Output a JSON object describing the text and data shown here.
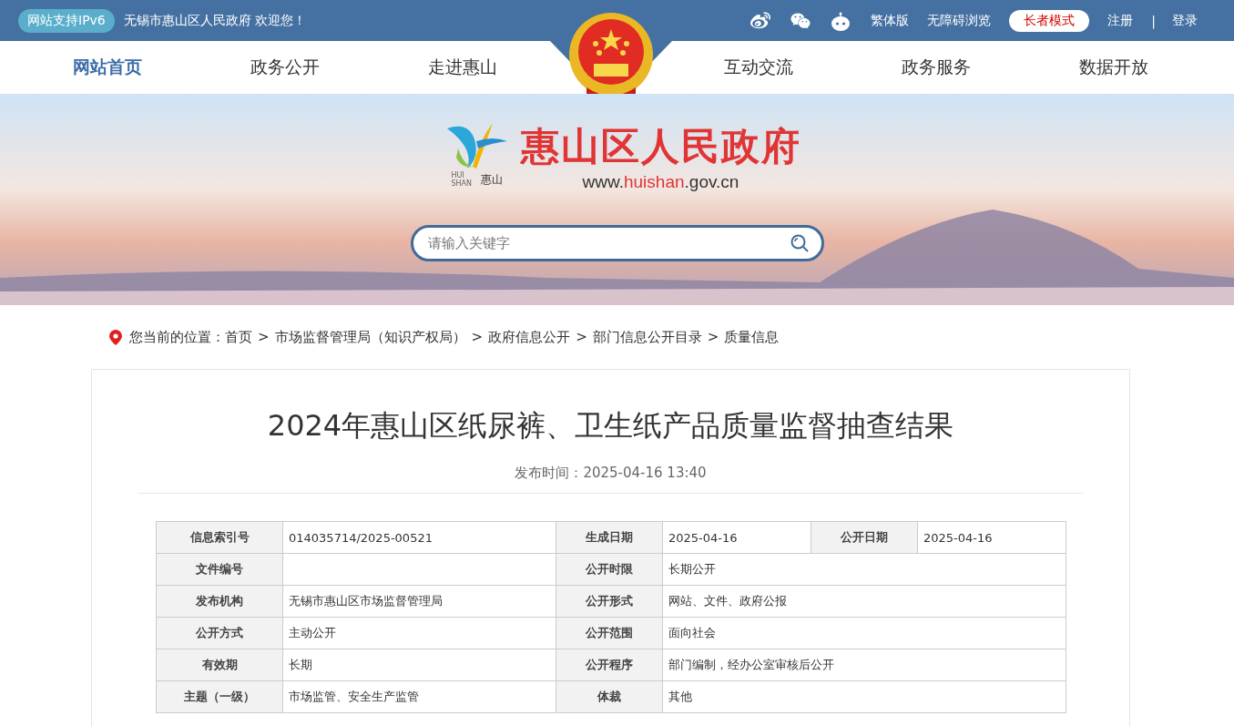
{
  "top_bar": {
    "ipv6_badge": "网站支持IPv6",
    "welcome": "无锡市惠山区人民政府 欢迎您！",
    "links": [
      "繁体版",
      "无障碍浏览"
    ],
    "elder_mode": "长者模式",
    "register": "注册",
    "divider": "|",
    "login": "登录"
  },
  "nav": {
    "items": [
      {
        "label": "网站首页",
        "selected": true
      },
      {
        "label": "政务公开",
        "selected": false
      },
      {
        "label": "走进惠山",
        "selected": false
      },
      {
        "label": "互动交流",
        "selected": false
      },
      {
        "label": "政务服务",
        "selected": false
      },
      {
        "label": "数据开放",
        "selected": false
      }
    ]
  },
  "banner": {
    "logo_latin": [
      "HUI",
      "SHAN"
    ],
    "logo_name": "惠山",
    "title": "惠山区人民政府",
    "url": [
      {
        "text": "www.",
        "highlight": false
      },
      {
        "text": "huishan",
        "highlight": true
      },
      {
        "text": ".gov.cn",
        "highlight": false
      }
    ],
    "search_placeholder": "请输入关键字"
  },
  "breadcrumb": {
    "label": "您当前的位置：",
    "items": [
      {
        "label": "首页"
      },
      {
        "separator": ">",
        "label": "市场监督管理局（知识产权局）"
      },
      {
        "separator": ">",
        "label": "政府信息公开"
      },
      {
        "separator": ">",
        "label": "部门信息公开目录"
      },
      {
        "separator": ">",
        "label": "质量信息"
      }
    ]
  },
  "article": {
    "title": "2024年惠山区纸尿裤、卫生纸产品质量监督抽查结果",
    "publish_time": "发布时间：2025-04-16 13:40"
  },
  "info_table": {
    "rows": [
      [
        {
          "label": "信息索引号",
          "value": "014035714/2025-00521"
        },
        {
          "label": "生成日期",
          "value": "2025-04-16"
        },
        {
          "label": "公开日期",
          "value": "2025-04-16"
        }
      ],
      [
        {
          "label": "文件编号"
        },
        {
          "label": "公开时限",
          "value": "长期公开"
        }
      ],
      [
        {
          "label": "发布机构",
          "value": "无锡市惠山区市场监督管理局"
        },
        {
          "label": "公开形式",
          "value": "网站、文件、政府公报"
        }
      ],
      [
        {
          "label": "公开方式",
          "value": "主动公开"
        },
        {
          "label": "公开范围",
          "value": "面向社会"
        }
      ],
      [
        {
          "label": "有效期",
          "value": "长期"
        },
        {
          "label": "公开程序",
          "value": "部门编制，经办公室审核后公开"
        }
      ],
      [
        {
          "label": "主题（一级）",
          "value": "市场监管、安全生产监管"
        },
        {
          "label": "体裁",
          "value": "其他"
        }
      ]
    ]
  }
}
